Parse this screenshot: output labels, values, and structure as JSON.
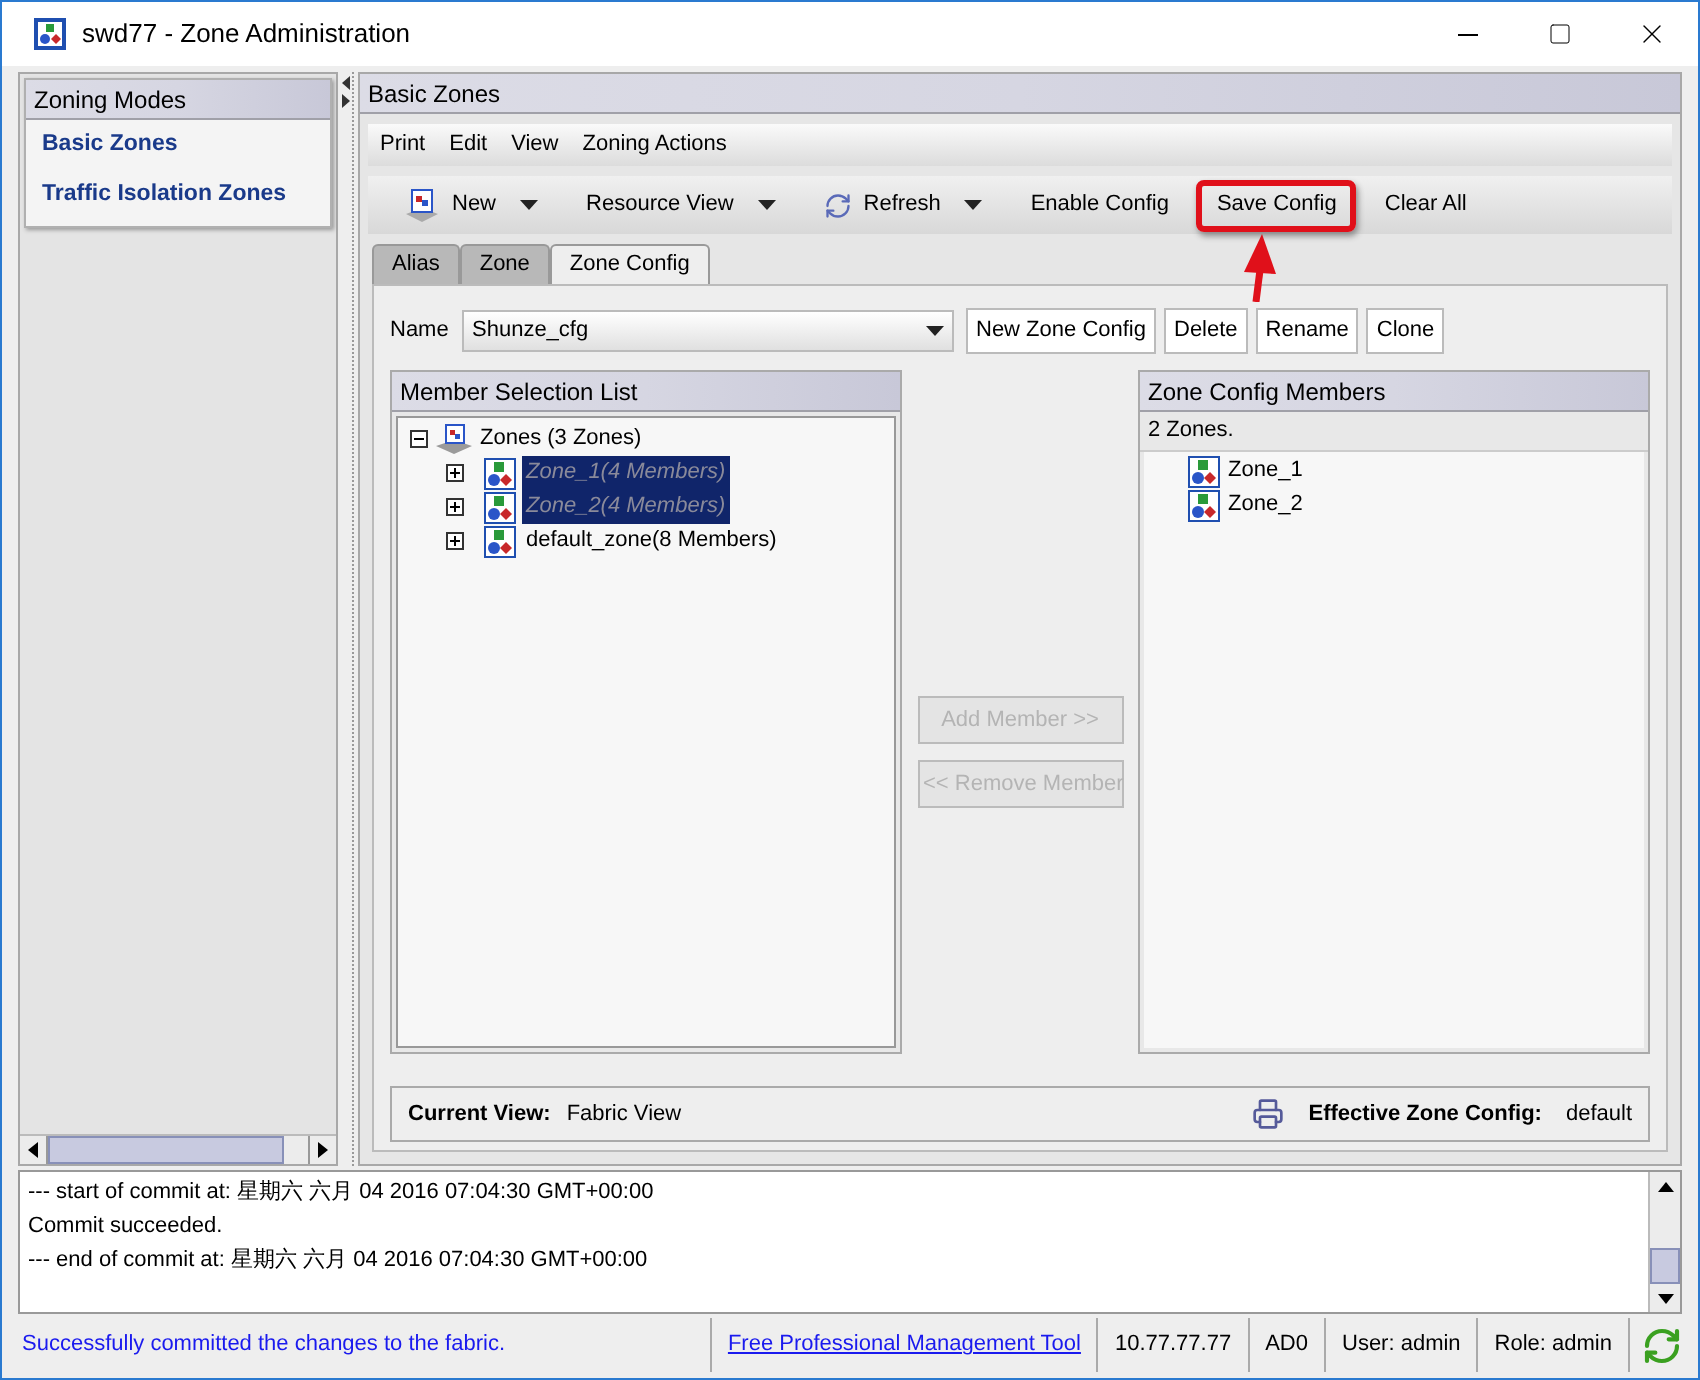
{
  "window": {
    "title": "swd77 - Zone Administration"
  },
  "sidebar": {
    "title": "Zoning Modes",
    "items": [
      {
        "label": "Basic Zones"
      },
      {
        "label": "Traffic Isolation Zones"
      }
    ]
  },
  "main": {
    "title": "Basic Zones",
    "menu": [
      "Print",
      "Edit",
      "View",
      "Zoning Actions"
    ],
    "toolbar": [
      {
        "label": "New",
        "kind": "new",
        "dropdown": true,
        "highlighted": false
      },
      {
        "label": "Resource View",
        "kind": "plain",
        "dropdown": true,
        "highlighted": false
      },
      {
        "label": "Refresh",
        "kind": "refresh",
        "dropdown": true,
        "highlighted": false
      },
      {
        "label": "Enable Config",
        "kind": "plain",
        "dropdown": false,
        "highlighted": false
      },
      {
        "label": "Save Config",
        "kind": "plain",
        "dropdown": false,
        "highlighted": true
      },
      {
        "label": "Clear All",
        "kind": "plain",
        "dropdown": false,
        "highlighted": false
      }
    ],
    "tabs": [
      {
        "label": "Alias",
        "selected": false
      },
      {
        "label": "Zone",
        "selected": false
      },
      {
        "label": "Zone Config",
        "selected": true
      }
    ],
    "name_field": {
      "label": "Name",
      "value": "Shunze_cfg"
    },
    "config_buttons": [
      "New Zone Config",
      "Delete",
      "Rename",
      "Clone"
    ],
    "member_list": {
      "title": "Member Selection List",
      "root": {
        "label": "Zones (3 Zones)",
        "expanded": true,
        "children": [
          {
            "label": "Zone_1(4 Members)",
            "selected": true
          },
          {
            "label": "Zone_2(4 Members)",
            "selected": true
          },
          {
            "label": "default_zone(8 Members)",
            "selected": false
          }
        ]
      }
    },
    "transfer_buttons": [
      {
        "label": "Add Member >>",
        "disabled": true
      },
      {
        "label": "<< Remove Member",
        "disabled": true
      }
    ],
    "config_members": {
      "title": "Zone Config Members",
      "count": "2 Zones.",
      "items": [
        "Zone_1",
        "Zone_2"
      ]
    },
    "footer": {
      "current_view_label": "Current View:",
      "current_view": "Fabric View",
      "effective_label": "Effective Zone Config:",
      "effective": "default"
    }
  },
  "log": [
    "--- start of commit at: 星期六 六月 04 2016 07:04:30 GMT+00:00",
    "Commit succeeded.",
    "--- end of commit at: 星期六 六月 04 2016 07:04:30 GMT+00:00"
  ],
  "status_bar": {
    "message": "Successfully committed the changes to the fabric.",
    "link": "Free Professional Management Tool",
    "ip": "10.77.77.77",
    "domain": "AD0",
    "user": "User: admin",
    "role": "Role: admin"
  }
}
